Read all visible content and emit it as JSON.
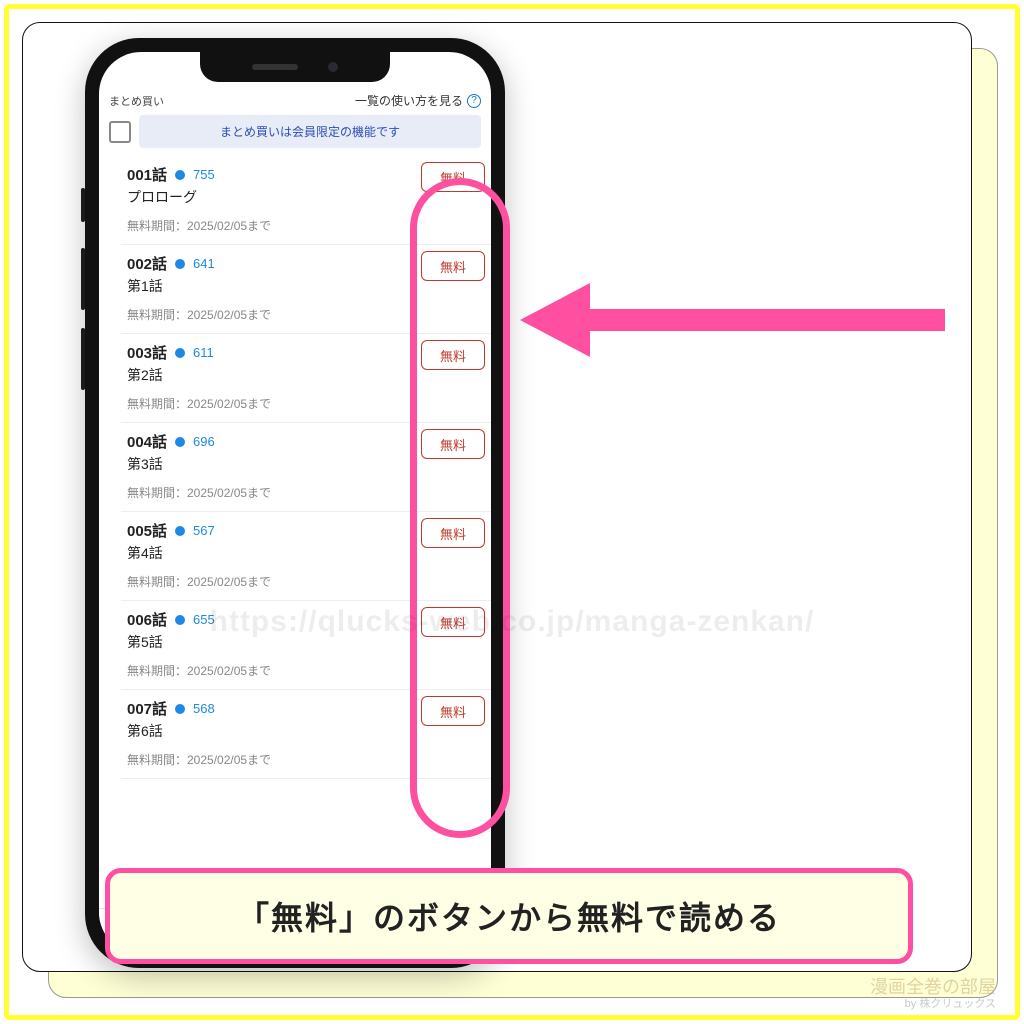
{
  "header": {
    "bulk_label": "まとめ買い",
    "guide_link": "一覧の使い方を見る",
    "banner": "まとめ買いは会員限定の機能です"
  },
  "episodes": [
    {
      "num": "001話",
      "count": "755",
      "title": "プロローグ",
      "period": "無料期間：2025/02/05まで",
      "btn": "無料"
    },
    {
      "num": "002話",
      "count": "641",
      "title": "第1話",
      "period": "無料期間：2025/02/05まで",
      "btn": "無料"
    },
    {
      "num": "003話",
      "count": "611",
      "title": "第2話",
      "period": "無料期間：2025/02/05まで",
      "btn": "無料"
    },
    {
      "num": "004話",
      "count": "696",
      "title": "第3話",
      "period": "無料期間：2025/02/05まで",
      "btn": "無料"
    },
    {
      "num": "005話",
      "count": "567",
      "title": "第4話",
      "period": "無料期間：2025/02/05まで",
      "btn": "無料"
    },
    {
      "num": "006話",
      "count": "655",
      "title": "第5話",
      "period": "無料期間：2025/02/05まで",
      "btn": "無料"
    },
    {
      "num": "007話",
      "count": "568",
      "title": "第6話",
      "period": "無料期間：2025/02/05まで",
      "btn": "無料"
    }
  ],
  "callout": "「無料」のボタンから無料で読める",
  "watermark": "https://qlucks-web.co.jp/manga-zenkan/",
  "credit": {
    "main": "漫画全巻の部屋",
    "sub": "by 株クリュックス"
  },
  "colors": {
    "accent_blue": "#1e88e5",
    "outline_pink": "#ff4fa0",
    "free_red": "#c0392b"
  }
}
